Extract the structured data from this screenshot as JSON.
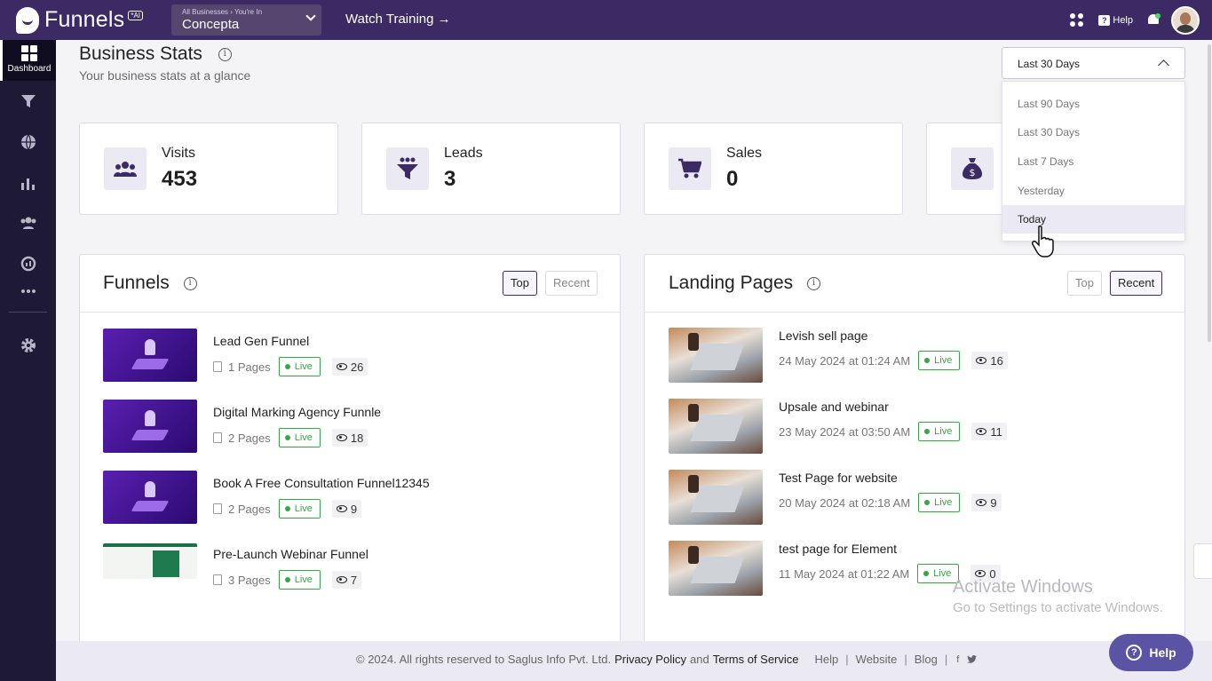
{
  "topbar": {
    "logo_text": "Funnels",
    "logo_badge": "*AI",
    "business_switcher_caption": "All Businesses › You're In",
    "business_name": "Concepta",
    "watch_training": "Watch Training →",
    "help_label": "Help",
    "help_glyph": "?"
  },
  "sidebar": {
    "dashboard_label": "Dashboard",
    "icons": [
      "dashboard-icon",
      "funnel-icon",
      "globe-icon",
      "analytics-icon",
      "contacts-icon",
      "reports-icon",
      "more-icon",
      "settings-icon"
    ]
  },
  "header": {
    "title": "Business Stats",
    "subtitle": "Your business stats at a glance",
    "info_glyph": "i"
  },
  "range_dropdown": {
    "selected": "Last 30 Days",
    "options": [
      "Last 90 Days",
      "Last 30 Days",
      "Last 7 Days",
      "Yesterday",
      "Today"
    ],
    "hovered": "Today"
  },
  "stats": [
    {
      "label": "Visits",
      "value": "453",
      "icon": "visits-icon"
    },
    {
      "label": "Leads",
      "value": "3",
      "icon": "leads-icon"
    },
    {
      "label": "Sales",
      "value": "0",
      "icon": "cart-icon"
    },
    {
      "label": "",
      "value": "",
      "icon": "money-bag-icon"
    }
  ],
  "funnels": {
    "title": "Funnels",
    "tabs": [
      "Top",
      "Recent"
    ],
    "active_tab": "Top",
    "items": [
      {
        "name": "Lead Gen Funnel",
        "pages": "1 Pages",
        "status": "Live",
        "views": "26"
      },
      {
        "name": "Digital Marking Agency Funnle",
        "pages": "2 Pages",
        "status": "Live",
        "views": "18"
      },
      {
        "name": "Book A Free Consultation Funnel12345",
        "pages": "2 Pages",
        "status": "Live",
        "views": "9"
      },
      {
        "name": "Pre-Launch Webinar Funnel",
        "pages": "3 Pages",
        "status": "Live",
        "views": "7"
      }
    ]
  },
  "landing_pages": {
    "title": "Landing Pages",
    "tabs": [
      "Top",
      "Recent"
    ],
    "active_tab": "Recent",
    "items": [
      {
        "name": "Levish sell page",
        "date": "24 May 2024 at 01:24 AM",
        "status": "Live",
        "views": "16"
      },
      {
        "name": "Upsale and webinar",
        "date": "23 May 2024 at 03:50 AM",
        "status": "Live",
        "views": "11"
      },
      {
        "name": "Test Page for website",
        "date": "20 May 2024 at 02:18 AM",
        "status": "Live",
        "views": "9"
      },
      {
        "name": "test page for Element",
        "date": "11 May 2024 at 01:22 AM",
        "status": "Live",
        "views": "0"
      }
    ]
  },
  "footer": {
    "copyright": "© 2024. All rights reserved to Saglus Info Pvt. Ltd.",
    "privacy": "Privacy Policy",
    "and": "and",
    "terms": "Terms of Service",
    "links": [
      "Help",
      "Website",
      "Blog"
    ],
    "social": [
      "f",
      "twitter-icon"
    ]
  },
  "watermark": {
    "line1": "Activate Windows",
    "line2": "Go to Settings to activate Windows."
  },
  "help_fab": {
    "label": "Help",
    "glyph": "?"
  },
  "colors": {
    "topbar": "#3b2a63",
    "sidebar": "#1e1934",
    "live": "#3aa34a",
    "help_fab": "#5b53a3"
  }
}
